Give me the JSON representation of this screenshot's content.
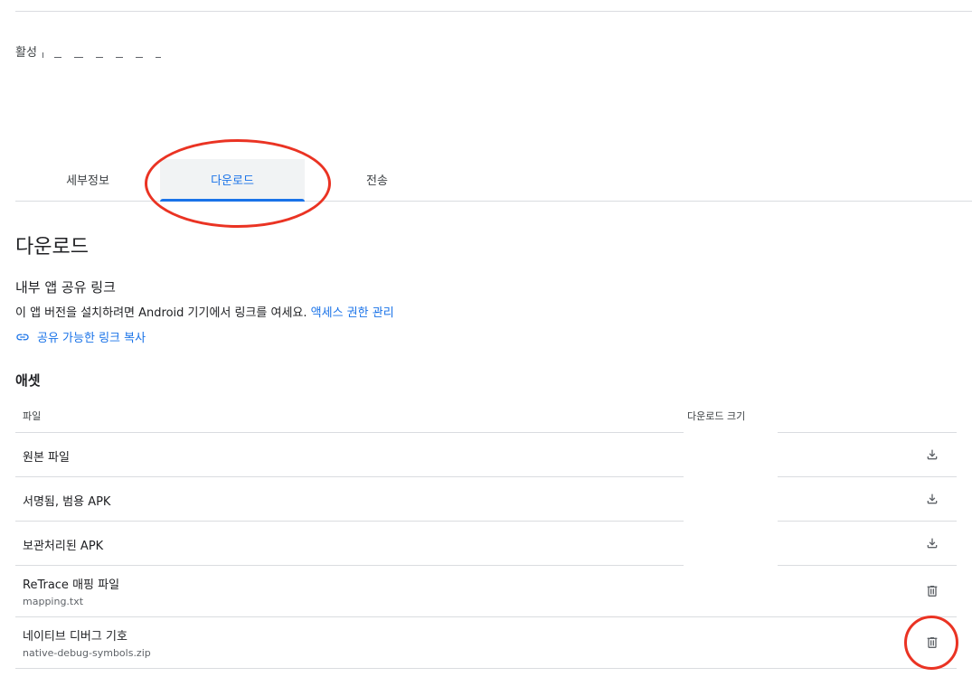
{
  "status": {
    "label": "활성"
  },
  "tabs": [
    {
      "label": "세부정보",
      "active": false
    },
    {
      "label": "다운로드",
      "active": true
    },
    {
      "label": "전송",
      "active": false
    }
  ],
  "page_title": "다운로드",
  "internal_share": {
    "title": "내부 앱 공유 링크",
    "description": "이 앱 버전을 설치하려면 Android 기기에서 링크를 여세요.",
    "manage_access_link": "액세스 권한 관리",
    "copy_link_label": "공유 가능한 링크 복사"
  },
  "assets": {
    "title": "애셋",
    "columns": {
      "file": "파일",
      "download_size": "다운로드 크기"
    },
    "rows": [
      {
        "name": "원본 파일",
        "sub": "",
        "action_icon": "download-icon"
      },
      {
        "name": "서명됨, 범용 APK",
        "sub": "",
        "action_icon": "download-icon"
      },
      {
        "name": "보관처리된 APK",
        "sub": "",
        "action_icon": "download-icon"
      },
      {
        "name": "ReTrace 매핑 파일",
        "sub": "mapping.txt",
        "action_icon": "trash-icon"
      },
      {
        "name": "네이티브 디버그 기호",
        "sub": "native-debug-symbols.zip",
        "action_icon": "trash-icon"
      }
    ]
  },
  "colors": {
    "accent": "#1a73e8",
    "annotation": "#ea3323",
    "divider": "#dadce0"
  }
}
